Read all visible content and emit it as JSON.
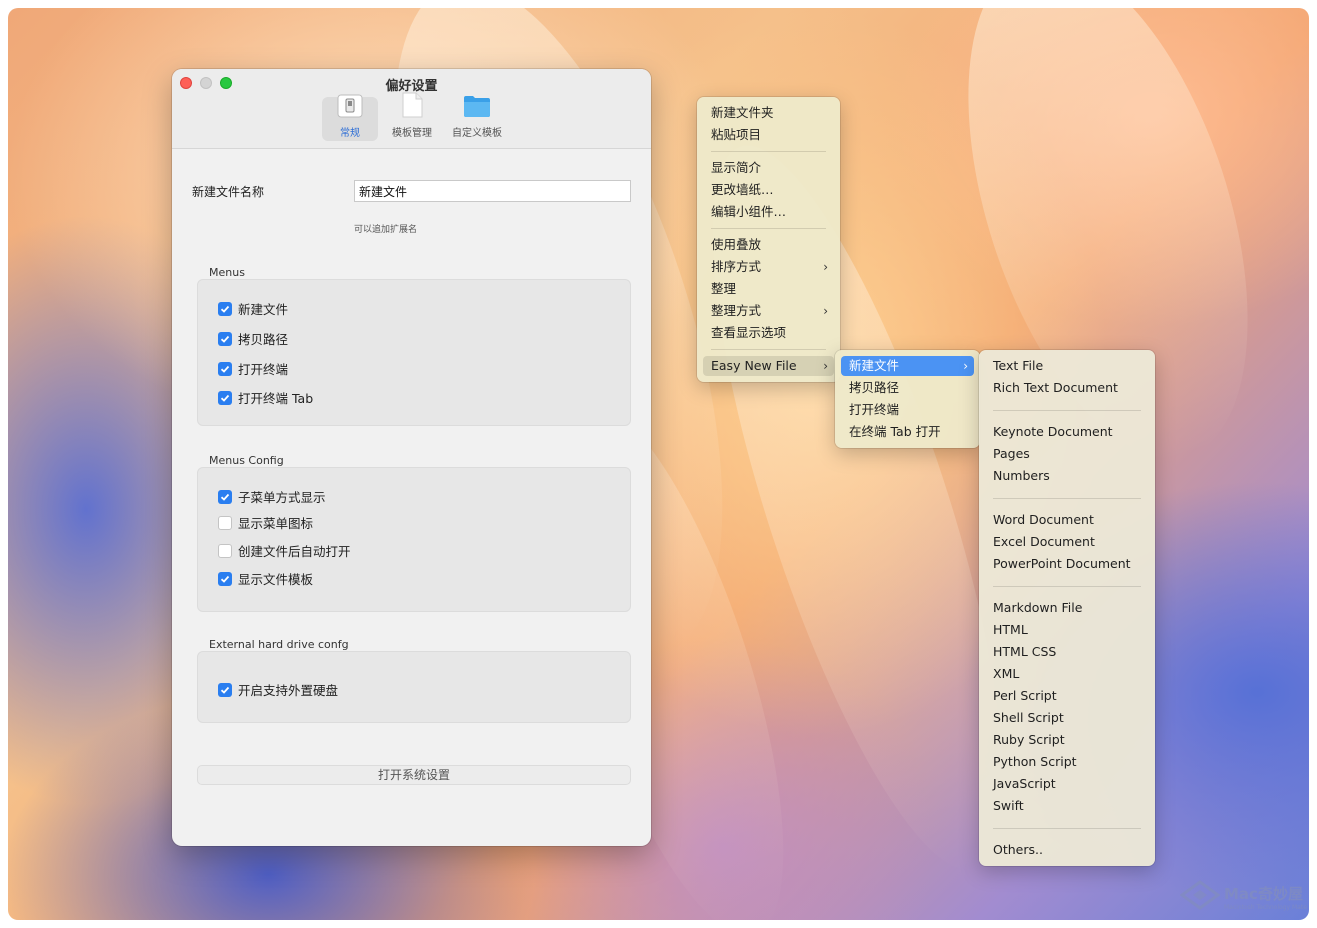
{
  "window": {
    "title": "偏好设置",
    "tabs": [
      {
        "label": "常规",
        "icon": "general-settings-icon",
        "active": true
      },
      {
        "label": "模板管理",
        "icon": "document-template-icon",
        "active": false
      },
      {
        "label": "自定义模板",
        "icon": "folder-icon",
        "active": false
      }
    ]
  },
  "general": {
    "name_label": "新建文件名称",
    "name_value": "新建文件",
    "hint": "可以追加扩展名"
  },
  "sections": {
    "menus": {
      "title": "Menus",
      "items": [
        {
          "label": "新建文件",
          "checked": true
        },
        {
          "label": "拷贝路径",
          "checked": true
        },
        {
          "label": "打开终端",
          "checked": true
        },
        {
          "label": "打开终端 Tab",
          "checked": true
        }
      ]
    },
    "menus_config": {
      "title": "Menus Config",
      "items": [
        {
          "label": "子菜单方式显示",
          "checked": true
        },
        {
          "label": "显示菜单图标",
          "checked": false
        },
        {
          "label": "创建文件后自动打开",
          "checked": false
        },
        {
          "label": "显示文件模板",
          "checked": true
        }
      ]
    },
    "external": {
      "title": "External hard drive confg",
      "items": [
        {
          "label": "开启支持外置硬盘",
          "checked": true
        }
      ]
    }
  },
  "open_system_settings": "打开系统设置",
  "context_menu": {
    "items": [
      "新建文件夹",
      "粘贴项目",
      "显示简介",
      "更改墙纸…",
      "编辑小组件…",
      "使用叠放",
      "排序方式",
      "整理",
      "整理方式",
      "查看显示选项",
      "Easy New File"
    ]
  },
  "submenu": {
    "items": [
      "新建文件",
      "拷贝路径",
      "打开终端",
      "在终端 Tab 打开"
    ]
  },
  "templates": {
    "items": [
      "Text File",
      "Rich Text Document",
      "Keynote Document",
      "Pages",
      "Numbers",
      "Word Document",
      "Excel Document",
      "PowerPoint Document",
      "Markdown File",
      "HTML",
      "HTML CSS",
      "XML",
      "Perl Script",
      "Shell Script",
      "Ruby Script",
      "Python Script",
      "JavaScript",
      "Swift",
      "Others.."
    ]
  },
  "watermark": {
    "text": "Mac奇妙屋",
    "subtext": "Macintosh Technology Mate"
  },
  "colors": {
    "accent": "#2a7ef0",
    "menu_highlight": "#4b93f3",
    "close": "#fe5f57",
    "maximize": "#28c840"
  }
}
